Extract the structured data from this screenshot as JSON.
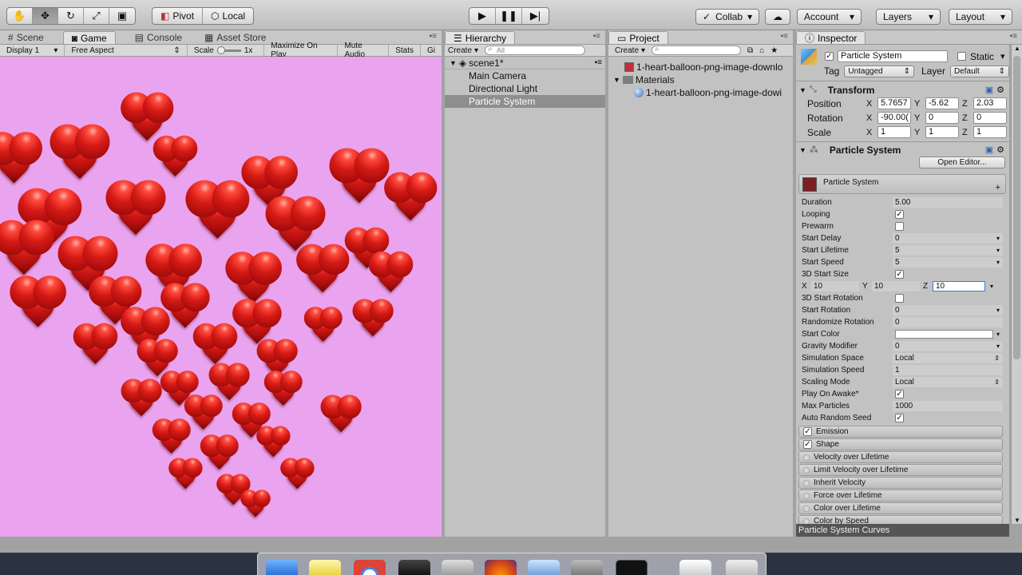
{
  "toolbar": {
    "pivot_label": "Pivot",
    "local_label": "Local",
    "collab_label": "Collab",
    "account_label": "Account",
    "layers_label": "Layers",
    "layout_label": "Layout"
  },
  "tabs": {
    "scene": "Scene",
    "game": "Game",
    "console": "Console",
    "asset_store": "Asset Store",
    "hierarchy": "Hierarchy",
    "project": "Project",
    "inspector": "Inspector"
  },
  "game_bar": {
    "display": "Display 1",
    "aspect": "Free Aspect",
    "scale_label": "Scale",
    "scale_value": "1x",
    "maximize": "Maximize On Play",
    "mute": "Mute Audio",
    "stats": "Stats",
    "gizmos": "Gi"
  },
  "hierarchy": {
    "create": "Create",
    "search_placeholder": "All",
    "scene": "scene1*",
    "items": [
      "Main Camera",
      "Directional Light",
      "Particle System"
    ]
  },
  "project": {
    "create": "Create",
    "items": [
      "1-heart-balloon-png-image-downlo",
      "Materials",
      "1-heart-balloon-png-image-dowi"
    ]
  },
  "inspector": {
    "object_name": "Particle System",
    "static_label": "Static",
    "tag_label": "Tag",
    "tag_value": "Untagged",
    "layer_label": "Layer",
    "layer_value": "Default",
    "transform": {
      "title": "Transform",
      "position": {
        "label": "Position",
        "x": "5.7657",
        "y": "-5.62",
        "z": "2.03"
      },
      "rotation": {
        "label": "Rotation",
        "x": "-90.00(",
        "y": "0",
        "z": "0"
      },
      "scale": {
        "label": "Scale",
        "x": "1",
        "y": "1",
        "z": "1"
      }
    },
    "particle_system": {
      "title": "Particle System",
      "open_editor": "Open Editor...",
      "module_title": "Particle System",
      "props": [
        {
          "label": "Duration",
          "value": "5.00"
        },
        {
          "label": "Looping",
          "value": "✓"
        },
        {
          "label": "Prewarm",
          "value": ""
        },
        {
          "label": "Start Delay",
          "value": "0"
        },
        {
          "label": "Start Lifetime",
          "value": "5"
        },
        {
          "label": "Start Speed",
          "value": "5"
        },
        {
          "label": "3D Start Size",
          "value": "✓"
        }
      ],
      "size": {
        "x": "10",
        "y": "10",
        "z": "10"
      },
      "props2": [
        {
          "label": "3D Start Rotation",
          "value": ""
        },
        {
          "label": "Start Rotation",
          "value": "0"
        },
        {
          "label": "Randomize Rotation",
          "value": "0"
        },
        {
          "label": "Start Color",
          "value": ""
        },
        {
          "label": "Gravity Modifier",
          "value": "0"
        },
        {
          "label": "Simulation Space",
          "value": "Local"
        },
        {
          "label": "Simulation Speed",
          "value": "1"
        },
        {
          "label": "Scaling Mode",
          "value": "Local"
        },
        {
          "label": "Play On Awake*",
          "value": "✓"
        },
        {
          "label": "Max Particles",
          "value": "1000"
        },
        {
          "label": "Auto Random Seed",
          "value": "✓"
        }
      ],
      "modules": [
        "Emission",
        "Shape",
        "Velocity over Lifetime",
        "Limit Velocity over Lifetime",
        "Inherit Velocity",
        "Force over Lifetime",
        "Color over Lifetime",
        "Color by Speed"
      ]
    },
    "curves_label": "Particle System Curves"
  }
}
